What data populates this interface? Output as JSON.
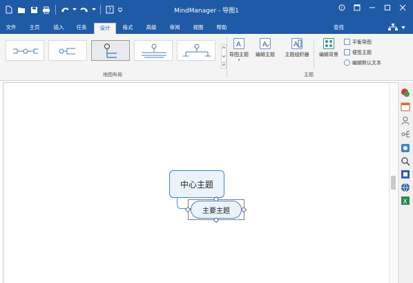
{
  "window": {
    "title": "MindManager - 导图1",
    "controls": [
      "help-icon",
      "ribbon-display-icon",
      "minimize-icon",
      "maximize-icon",
      "close-icon"
    ]
  },
  "quick_access": [
    "new-icon",
    "open-icon",
    "save-icon",
    "print-icon",
    "undo-icon",
    "redo-icon",
    "help-icon",
    "customize-icon"
  ],
  "tabs": [
    "文件",
    "主页",
    "插入",
    "任务",
    "设计",
    "格式",
    "高级",
    "审阅",
    "视图",
    "帮助"
  ],
  "active_tab": "设计",
  "search_label": "查找",
  "ribbon": {
    "layout_group_label": "地图布局",
    "topic_group_label": "主题",
    "buttons": [
      {
        "label": "导图主题",
        "icon": "map-theme-icon"
      },
      {
        "label": "编辑主题",
        "icon": "edit-theme-icon"
      },
      {
        "label": "主题组织器",
        "icon": "theme-organizer-icon"
      },
      {
        "label": "编辑背景",
        "icon": "edit-background-icon"
      }
    ],
    "small_buttons": [
      {
        "label": "平衡导图",
        "icon": "balance-map-icon"
      },
      {
        "label": "便签主题",
        "icon": "note-topic-icon"
      },
      {
        "label": "编辑默认文本",
        "icon": "edit-default-text-icon"
      }
    ],
    "layouts": [
      "layout-map",
      "layout-right-map",
      "layout-org-chart",
      "layout-tree",
      "layout-timeline"
    ],
    "selected_layout": "layout-org-chart"
  },
  "canvas": {
    "central_topic": "中心主题",
    "main_topic": "主要主题"
  },
  "side_panel": [
    "task-info-icon",
    "calendar-icon",
    "resources-icon",
    "map-parts-icon",
    "library-icon",
    "search-icon",
    "index-icon",
    "browser-icon",
    "excel-icon"
  ],
  "colors": {
    "title_bar": "#1f5aa6",
    "topic_border": "#3f84c8",
    "topic_fill": "#eaf2fa"
  }
}
